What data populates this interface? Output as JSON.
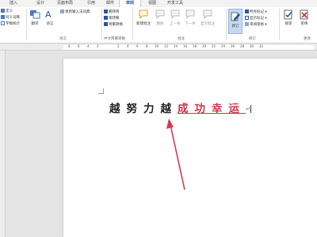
{
  "colors": {
    "accent": "#2b579a",
    "track_changes": "#d0334a",
    "annotation_arrow": "#d7384a"
  },
  "tabs": [
    {
      "label": "插入"
    },
    {
      "label": "设计"
    },
    {
      "label": "页面布局"
    },
    {
      "label": "引用"
    },
    {
      "label": "邮件"
    },
    {
      "label": "审阅",
      "active": true
    },
    {
      "label": "视图"
    },
    {
      "label": "开发工具"
    }
  ],
  "ribbon": {
    "proofing": {
      "item1": "定义",
      "item2": "同义词库",
      "item3": "字数统计"
    },
    "language": {
      "translate": "翻译",
      "language": "语言",
      "update_ime": "更新输入法词典",
      "group": "语言"
    },
    "chinese_conversion": {
      "to_simplified": "繁转简",
      "to_traditional": "简转繁",
      "convert": "简繁转换",
      "group": "中文简繁转换"
    },
    "comments": {
      "new": "新建批注",
      "delete": "删除",
      "previous": "上一条",
      "next": "下一条",
      "show": "显示批注",
      "group": "批注"
    },
    "tracking": {
      "track_changes": "修订",
      "markup_mode": "所有标记",
      "show_markup": "显示标记",
      "reviewing_pane": "审阅窗格",
      "group": "修订"
    },
    "changes": {
      "accept": "接受",
      "reject": "拒绝",
      "group": "更改"
    }
  },
  "ruler": {
    "ticks": [
      "8",
      "6",
      "4",
      "2",
      "2",
      "4",
      "6",
      "8",
      "10",
      "12",
      "14",
      "16",
      "18",
      "20",
      "22",
      "24",
      "26",
      "28",
      "30",
      "32"
    ]
  },
  "document": {
    "original_text": "越努力越",
    "inserted_text": "成功幸运"
  }
}
